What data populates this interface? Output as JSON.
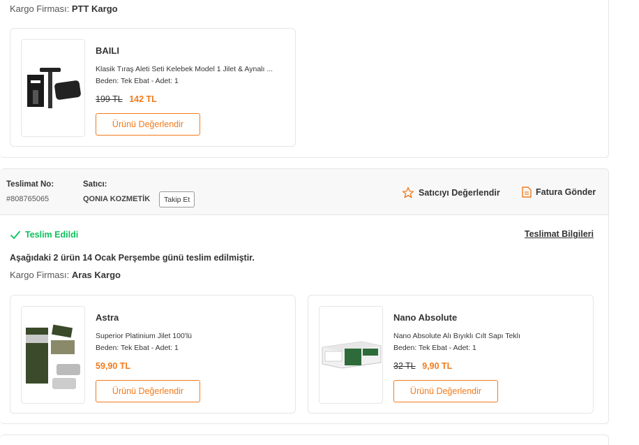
{
  "top": {
    "cargo_label": "Kargo Firması:",
    "cargo_value": "PTT Kargo",
    "product": {
      "brand": "BAILI",
      "description": "Klasik Tıraş Aleti Seti Kelebek Model 1 Jilet & Aynalı ...",
      "size": "Beden: Tek Ebat - Adet: 1",
      "old_price": "199 TL",
      "new_price": "142 TL",
      "rate_label": "Ürünü Değerlendir"
    }
  },
  "shipment": {
    "no_label": "Teslimat No:",
    "no_value": "#808765065",
    "seller_label": "Satıcı:",
    "seller_value": "QONIA KOZMETİK",
    "follow_label": "Takip Et",
    "rate_seller_label": "Satıcıyı Değerlendir",
    "invoice_label": "Fatura Gönder",
    "status": "Teslim Edildi",
    "info_link": "Teslimat Bilgileri",
    "summary": "Aşağıdaki 2 ürün 14 Ocak Perşembe günü teslim edilmiştir.",
    "cargo_label": "Kargo Firması:",
    "cargo_value": "Aras Kargo",
    "products": [
      {
        "brand": "Astra",
        "description": "Superior Platinium Jilet 100'lü",
        "size": "Beden: Tek Ebat - Adet: 1",
        "new_price": "59,90 TL",
        "rate_label": "Ürünü Değerlendir"
      },
      {
        "brand": "Nano Absolute",
        "description": "Nano Absolute Alı Bıyıklı Cılt Sapı Teklı",
        "size": "Beden: Tek Ebat - Adet: 1",
        "old_price": "32 TL",
        "new_price": "9,90 TL",
        "rate_label": "Ürünü Değerlendir"
      }
    ]
  },
  "colors": {
    "accent": "#f27a1a",
    "success": "#0bc15c",
    "border": "#e6e6e6"
  }
}
